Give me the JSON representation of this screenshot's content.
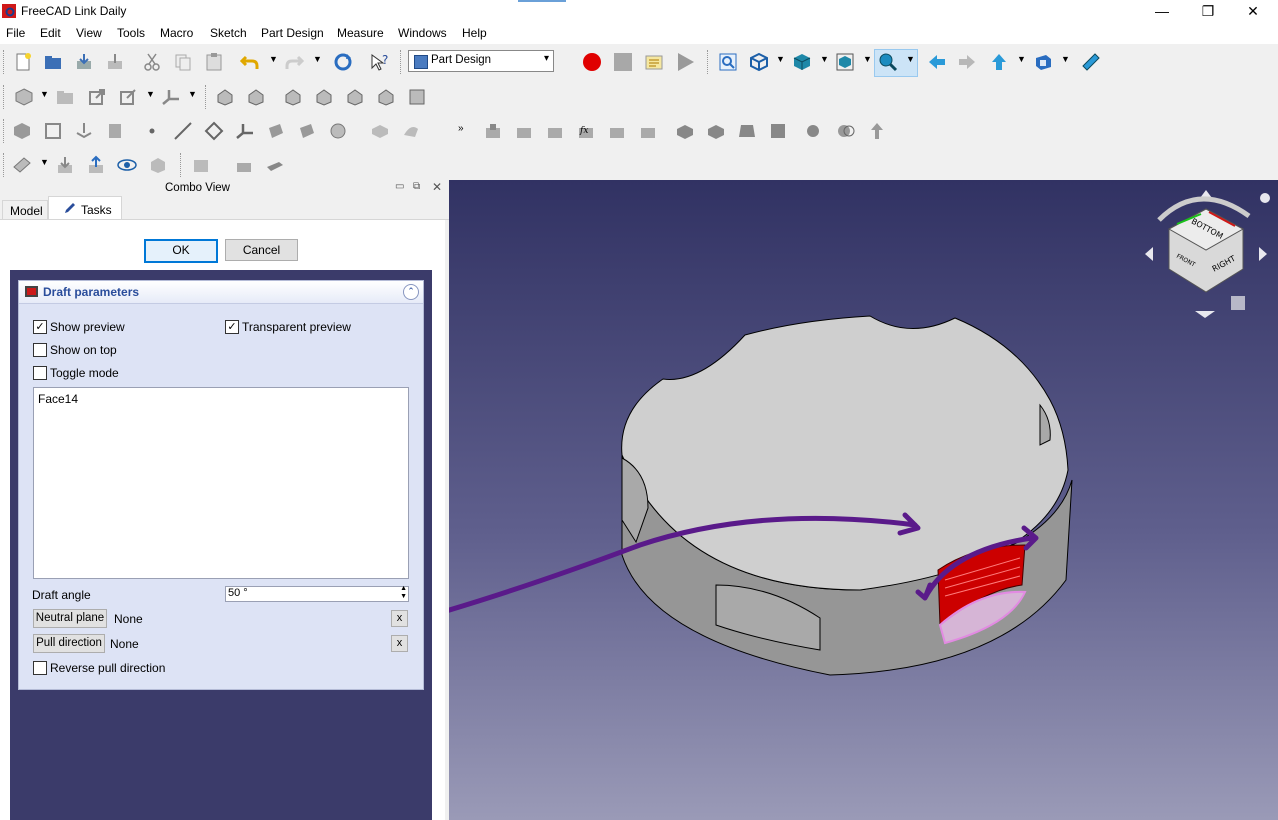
{
  "window": {
    "title": "FreeCAD Link Daily",
    "minimize": "—",
    "restore": "❐",
    "close": "✕"
  },
  "menu": [
    "File",
    "Edit",
    "View",
    "Tools",
    "Macro",
    "Sketch",
    "Part Design",
    "Measure",
    "Windows",
    "Help"
  ],
  "toolbar": {
    "workbench": "Part Design"
  },
  "combo_view": {
    "title": "Combo View",
    "tabs": [
      "Model",
      "Tasks"
    ],
    "active_tab": "Tasks",
    "ok_label": "OK",
    "cancel_label": "Cancel"
  },
  "draft_panel": {
    "title": "Draft parameters",
    "show_preview": {
      "label": "Show preview",
      "checked": true
    },
    "transparent_preview": {
      "label": "Transparent preview",
      "checked": true
    },
    "show_on_top": {
      "label": "Show on top",
      "checked": false
    },
    "toggle_mode": {
      "label": "Toggle mode",
      "checked": false
    },
    "faces": [
      "Face14"
    ],
    "draft_angle_label": "Draft angle",
    "draft_angle_value": "50 °",
    "neutral_plane_button": "Neutral plane",
    "neutral_plane_value": "None",
    "pull_direction_button": "Pull direction",
    "pull_direction_value": "None",
    "clear_label": "x",
    "reverse_pull": {
      "label": "Reverse pull direction",
      "checked": false
    }
  },
  "navcube": {
    "top": "BOTTOM",
    "right": "RIGHT",
    "front": "FRONT"
  },
  "colors": {
    "annotation": "#5a1a8a",
    "selection": "#cc0000",
    "preview": "#e28ae2",
    "accent": "#2a4d9b"
  }
}
